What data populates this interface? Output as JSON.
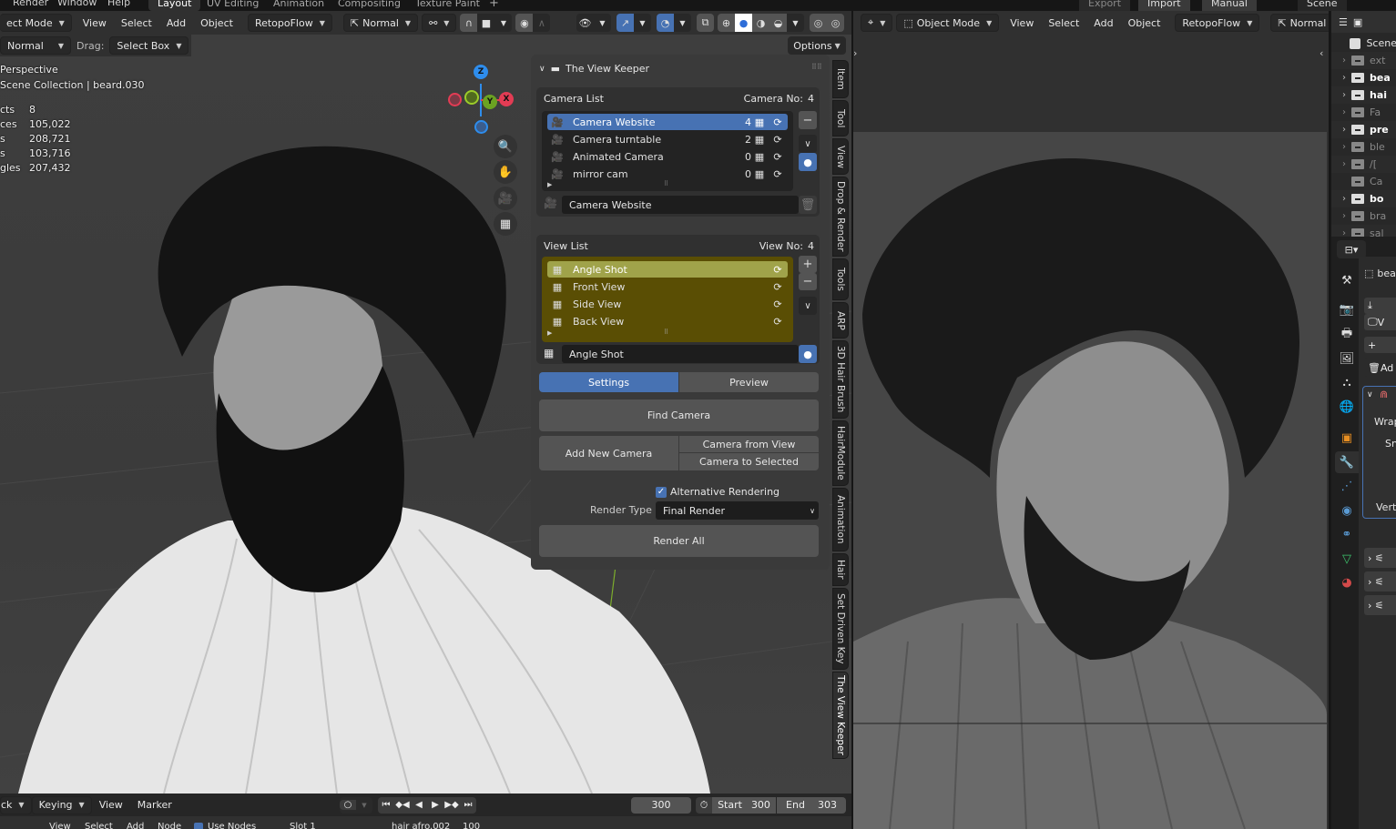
{
  "topbar": {
    "menus": [
      "Render",
      "Window",
      "Help"
    ],
    "workspaces": [
      "Layout",
      "UV Editing",
      "Animation",
      "Compositing",
      "Texture Paint"
    ],
    "active_workspace": "Layout",
    "add_workspace": "+",
    "right_buttons": [
      "Export",
      "Import",
      "Manual"
    ],
    "scene_label": "Scene"
  },
  "left_viewport": {
    "header": {
      "mode": "ect Mode",
      "menus": [
        "View",
        "Select",
        "Add",
        "Object"
      ],
      "addon_menu": "RetopoFlow",
      "transform_orientation": "Normal",
      "options_label": "Options"
    },
    "tool_header": {
      "orientation": "Normal",
      "drag_label": "Drag:",
      "drag_value": "Select Box"
    },
    "overlay": {
      "view_name": "Perspective",
      "collection": "Scene Collection | beard.030",
      "stats": [
        {
          "label": "cts",
          "value": "8"
        },
        {
          "label": "ces",
          "value": "105,022"
        },
        {
          "label": "s",
          "value": "208,721"
        },
        {
          "label": "s",
          "value": "103,716"
        },
        {
          "label": "gles",
          "value": "207,432"
        }
      ]
    },
    "gizmo": {
      "x": "X",
      "y": "Y",
      "z": "Z"
    },
    "nav_buttons": [
      "zoom",
      "pan",
      "camera",
      "ortho-toggle"
    ]
  },
  "view_keeper": {
    "title": "The View Keeper",
    "camera_list": {
      "label": "Camera List",
      "count_label": "Camera No:",
      "count": "4",
      "items": [
        {
          "name": "Camera Website",
          "views": "4",
          "active": true
        },
        {
          "name": "Camera turntable",
          "views": "2",
          "active": false
        },
        {
          "name": "Animated Camera",
          "views": "0",
          "active": false
        },
        {
          "name": "mirror cam",
          "views": "0",
          "active": false
        }
      ],
      "selected_name": "Camera Website"
    },
    "view_list": {
      "label": "View List",
      "count_label": "View No:",
      "count": "4",
      "items": [
        {
          "name": "Angle Shot",
          "active": true
        },
        {
          "name": "Front View",
          "active": false
        },
        {
          "name": "Side View",
          "active": false
        },
        {
          "name": "Back View",
          "active": false
        }
      ],
      "selected_name": "Angle Shot"
    },
    "tabs": {
      "settings": "Settings",
      "preview": "Preview",
      "active": "Settings"
    },
    "find_camera": "Find Camera",
    "add_new_camera": "Add New Camera",
    "camera_from_view": "Camera from View",
    "camera_to_selected": "Camera to Selected",
    "alt_rendering_label": "Alternative Rendering",
    "alt_rendering_checked": true,
    "render_type_label": "Render Type",
    "render_type_value": "Final Render",
    "render_all": "Render All"
  },
  "sidebar_tabs": [
    "Item",
    "Tool",
    "View",
    "Drop & Render",
    "Tools",
    "ARP",
    "3D Hair Brush",
    "HairModule",
    "Animation",
    "Hair",
    "Set Driven Key",
    "The View Keeper"
  ],
  "active_sidebar_tab": "The View Keeper",
  "timeline": {
    "menus": [
      "ck",
      "Keying",
      "View",
      "Marker"
    ],
    "current_frame": "300",
    "start_label": "Start",
    "start": "300",
    "end_label": "End",
    "end": "303"
  },
  "node_bar": {
    "menus": [
      "View",
      "Select",
      "Add",
      "Node"
    ],
    "use_nodes_label": "Use Nodes",
    "slot": "Slot 1",
    "material": "hair afro.002",
    "users": "100"
  },
  "right_viewport": {
    "header": {
      "mode": "Object Mode",
      "menus": [
        "View",
        "Select",
        "Add",
        "Object"
      ],
      "addon_menu": "RetopoFlow",
      "transform_orientation": "Normal"
    }
  },
  "outliner": {
    "root": "Scene",
    "rows": [
      {
        "name": "ext",
        "dim": true,
        "arrow": true
      },
      {
        "name": "bea",
        "dim": false,
        "arrow": true
      },
      {
        "name": "hai",
        "dim": false,
        "arrow": true
      },
      {
        "name": "Fa",
        "dim": true,
        "arrow": true
      },
      {
        "name": "pre",
        "dim": false,
        "arrow": true
      },
      {
        "name": "ble",
        "dim": true,
        "arrow": true
      },
      {
        "name": "/[",
        "dim": true,
        "arrow": true
      },
      {
        "name": "Ca",
        "dim": true,
        "arrow": false
      },
      {
        "name": "bo",
        "dim": false,
        "arrow": true
      },
      {
        "name": "bra",
        "dim": true,
        "arrow": true
      },
      {
        "name": "sal",
        "dim": true,
        "arrow": true
      }
    ]
  },
  "properties": {
    "object_name": "bea",
    "rows": [
      "",
      "V",
      "",
      "Ad"
    ],
    "modifier_labels": [
      "Wrap",
      "Sn",
      "Verte"
    ],
    "colors": {
      "modifier": "#5a9bd5",
      "object": "#e88f22",
      "physics": "#d44a4a",
      "data": "#3ec46d"
    }
  }
}
